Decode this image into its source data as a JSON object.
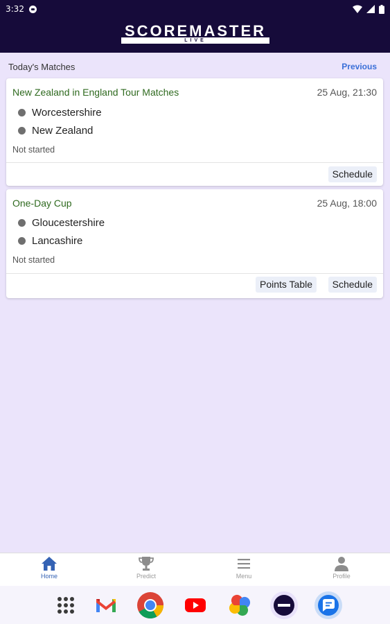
{
  "status_bar": {
    "time": "3:32"
  },
  "app": {
    "logo_text": "SCOREMASTER",
    "logo_sub": "LIVE"
  },
  "section": {
    "title": "Today's Matches",
    "previous_label": "Previous"
  },
  "matches": [
    {
      "series": "New Zealand in England Tour Matches",
      "datetime": "25 Aug, 21:30",
      "teams": [
        "Worcestershire",
        "New Zealand"
      ],
      "status": "Not started",
      "actions": [
        "Schedule"
      ]
    },
    {
      "series": "One-Day Cup",
      "datetime": "25 Aug, 18:00",
      "teams": [
        "Gloucestershire",
        "Lancashire"
      ],
      "status": "Not started",
      "actions": [
        "Points Table",
        "Schedule"
      ]
    }
  ],
  "bottom_nav": [
    {
      "label": "Home",
      "icon": "home-icon",
      "active": true
    },
    {
      "label": "Predict",
      "icon": "trophy-icon",
      "active": false
    },
    {
      "label": "Menu",
      "icon": "menu-icon",
      "active": false
    },
    {
      "label": "Profile",
      "icon": "profile-icon",
      "active": false
    }
  ],
  "dock": [
    "app-drawer-icon",
    "gmail-icon",
    "chrome-icon",
    "youtube-icon",
    "photos-icon",
    "app-icon",
    "messages-icon"
  ],
  "colors": {
    "header": "#160b3a",
    "background": "#ebe4fb",
    "series_green": "#2f6a1f",
    "link_blue": "#3a6fd8",
    "nav_active": "#3462b4"
  }
}
